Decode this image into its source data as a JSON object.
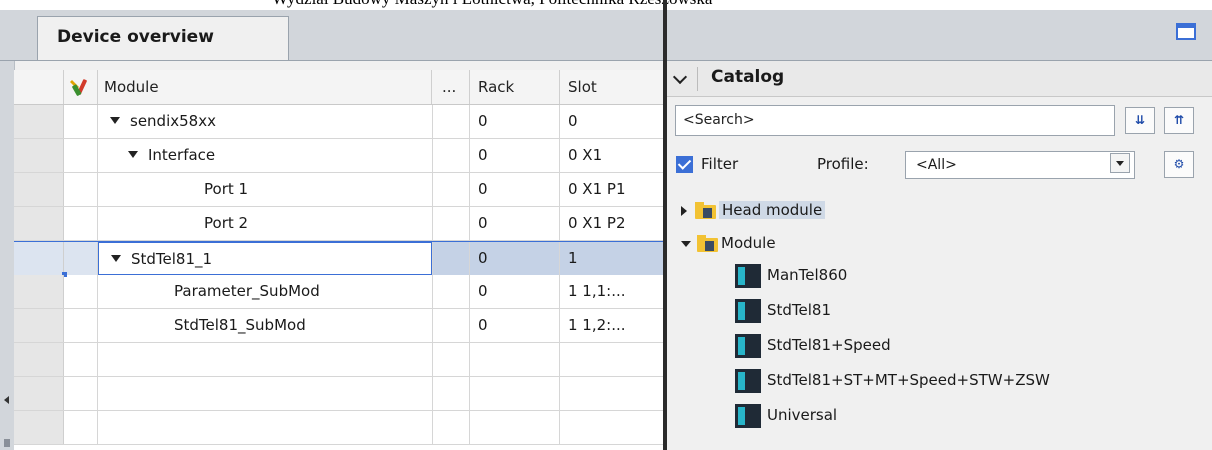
{
  "caption": "Wydział Budowy Maszyn i Lotnictwa, Politechnika Rzeszowska",
  "device_overview": {
    "tab_label": "Device overview",
    "columns": {
      "module": "Module",
      "more": "...",
      "rack": "Rack",
      "slot": "Slot"
    },
    "rows": [
      {
        "module": "sendix58xx",
        "rack": "0",
        "slot": "0"
      },
      {
        "module": "Interface",
        "rack": "0",
        "slot": "0 X1"
      },
      {
        "module": "Port 1",
        "rack": "0",
        "slot": "0 X1 P1"
      },
      {
        "module": "Port 2",
        "rack": "0",
        "slot": "0 X1 P2"
      },
      {
        "module": "StdTel81_1",
        "rack": "0",
        "slot": "1"
      },
      {
        "module": "Parameter_SubMod",
        "rack": "0",
        "slot": "1 1,1:..."
      },
      {
        "module": "StdTel81_SubMod",
        "rack": "0",
        "slot": "1 1,2:..."
      }
    ],
    "selected_row": "StdTel81_1"
  },
  "catalog": {
    "title": "Catalog",
    "search_value": "<Search>",
    "filter_label": "Filter",
    "filter_checked": true,
    "profile_label": "Profile:",
    "profile_value": "<All>",
    "tree": {
      "head_module": "Head module",
      "module": "Module",
      "children": [
        "ManTel860",
        "StdTel81",
        "StdTel81+Speed",
        "StdTel81+ST+MT+Speed+STW+ZSW",
        "Universal"
      ]
    }
  },
  "colors": {
    "accent": "#3b6fd6",
    "selection": "#c5d2e6",
    "panel": "#f0f0f0"
  }
}
